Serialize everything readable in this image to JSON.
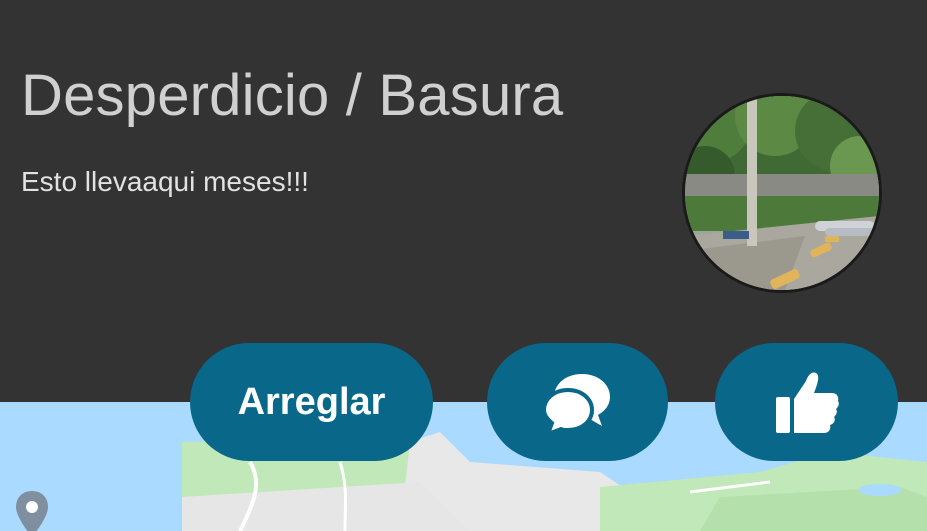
{
  "report": {
    "title": "Desperdicio / Basura",
    "description": "Esto llevaaqui meses!!!",
    "photo_icon": "report-photo"
  },
  "actions": {
    "fix_label": "Arreglar",
    "comment_icon": "comments-icon",
    "like_icon": "thumbs-up-icon"
  },
  "map": {
    "marker_icon": "map-pin-icon"
  },
  "colors": {
    "header_bg": "#333333",
    "title_text": "#d0d0d0",
    "button_bg": "#09678a",
    "water": "#aadaff",
    "land_green": "#c1e8b9"
  }
}
